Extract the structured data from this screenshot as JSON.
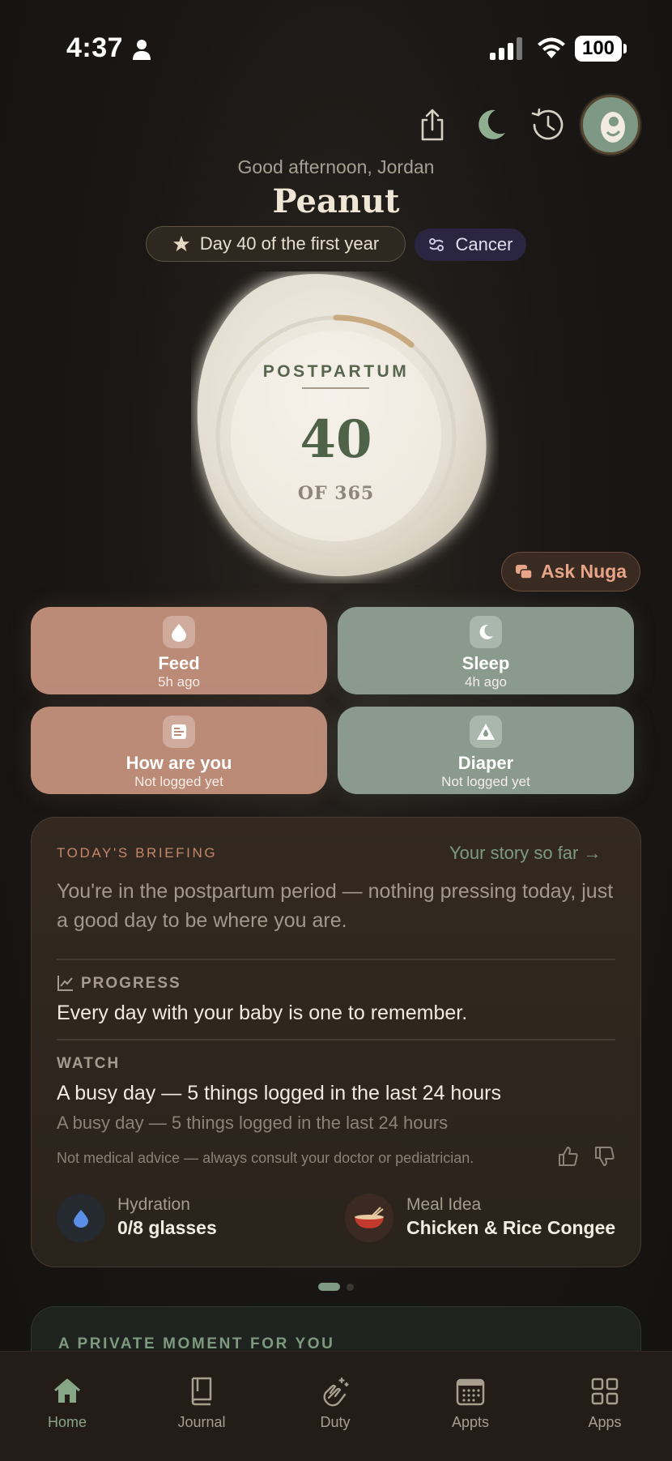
{
  "status_bar": {
    "time": "4:37",
    "battery": "100"
  },
  "header": {
    "greeting": "Good afternoon, Jordan",
    "baby_name": "Peanut",
    "day_pill": "Day 40 of the first year",
    "zodiac": "Cancer"
  },
  "progress_ring": {
    "label": "POSTPARTUM",
    "day": "40",
    "of_total": "OF 365",
    "progress_fraction": 0.11
  },
  "ask_button": "Ask Nuga",
  "tiles": [
    {
      "name": "Feed",
      "sub": "5h ago",
      "icon": "drop-icon"
    },
    {
      "name": "Sleep",
      "sub": "4h ago",
      "icon": "moon-icon"
    },
    {
      "name": "How are you",
      "sub": "Not logged yet",
      "icon": "note-icon"
    },
    {
      "name": "Diaper",
      "sub": "Not logged yet",
      "icon": "diaper-icon"
    }
  ],
  "briefing": {
    "label": "TODAY'S BRIEFING",
    "story_link": "Your story so far →",
    "body": "You're in the postpartum period — nothing pressing today, just a good day to be where you are.",
    "progress_label": "PROGRESS",
    "progress_text": "Every day with your baby is one to remember.",
    "watch_label": "WATCH",
    "watch_title": "A busy day — 5 things logged in the last 24 hours",
    "watch_sub": "A busy day — 5 things logged in the last 24 hours",
    "disclaimer": "Not medical advice — always consult your doctor or pediatrician.",
    "hydration_label": "Hydration",
    "hydration_value": "0/8 glasses",
    "meal_label": "Meal Idea",
    "meal_value": "Chicken & Rice Congee"
  },
  "private_moment": "A PRIVATE MOMENT FOR YOU",
  "tab_bar": [
    {
      "label": "Home",
      "icon": "home-icon",
      "active": true
    },
    {
      "label": "Journal",
      "icon": "book-icon",
      "active": false
    },
    {
      "label": "Duty",
      "icon": "hands-icon",
      "active": false
    },
    {
      "label": "Appts",
      "icon": "calendar-icon",
      "active": false
    },
    {
      "label": "Apps",
      "icon": "grid-icon",
      "active": false
    }
  ],
  "colors": {
    "background": "#1a1715",
    "peach_tile": "#bb8b78",
    "sage_tile": "#8a9b8d",
    "accent_green": "#7d9a7e",
    "accent_orange": "#c5876b"
  }
}
